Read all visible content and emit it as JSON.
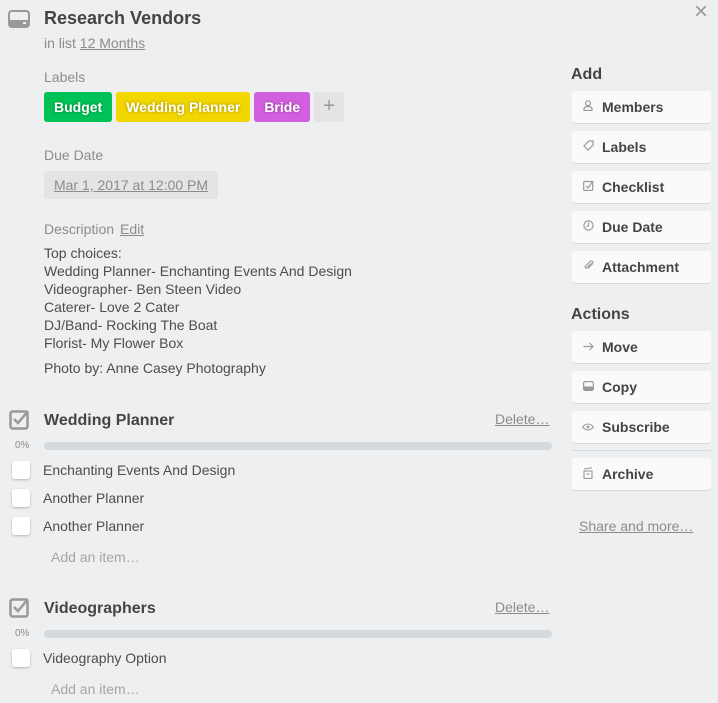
{
  "card": {
    "title": "Research Vendors",
    "in_list_prefix": "in list",
    "list_name": "12 Months"
  },
  "labels_section": {
    "heading": "Labels",
    "labels": [
      {
        "name": "Budget",
        "color": "#00c256"
      },
      {
        "name": "Wedding Planner",
        "color": "#f2d600"
      },
      {
        "name": "Bride",
        "color": "#d25fdf"
      }
    ],
    "add_symbol": "+"
  },
  "due_date": {
    "heading": "Due Date",
    "value": "Mar 1, 2017 at 12:00 PM"
  },
  "description": {
    "heading": "Description",
    "edit_label": "Edit",
    "lines": [
      "Top choices:",
      "Wedding Planner- Enchanting Events And Design",
      "Videographer- Ben Steen Video",
      "Caterer- Love 2 Cater",
      "DJ/Band- Rocking The Boat",
      "Florist- My Flower Box"
    ],
    "credit": "Photo by: Anne Casey Photography"
  },
  "checklists": [
    {
      "title": "Wedding Planner",
      "delete_label": "Delete…",
      "progress_percent": 0,
      "progress_text": "0%",
      "items": [
        "Enchanting Events And Design",
        "Another Planner",
        "Another Planner"
      ],
      "add_item_label": "Add an item…"
    },
    {
      "title": "Videographers",
      "delete_label": "Delete…",
      "progress_percent": 0,
      "progress_text": "0%",
      "items": [
        "Videography Option"
      ],
      "add_item_label": "Add an item…"
    }
  ],
  "sidebar": {
    "add_heading": "Add",
    "add_buttons": [
      {
        "label": "Members",
        "icon": "person-icon"
      },
      {
        "label": "Labels",
        "icon": "tag-icon"
      },
      {
        "label": "Checklist",
        "icon": "checkbox-icon"
      },
      {
        "label": "Due Date",
        "icon": "clock-icon"
      },
      {
        "label": "Attachment",
        "icon": "paperclip-icon"
      }
    ],
    "actions_heading": "Actions",
    "action_buttons": [
      {
        "label": "Move",
        "icon": "arrow-right-icon"
      },
      {
        "label": "Copy",
        "icon": "card-icon"
      },
      {
        "label": "Subscribe",
        "icon": "eye-icon"
      },
      {
        "label": "Archive",
        "icon": "archive-icon"
      }
    ],
    "share_label": "Share and more…"
  },
  "close_symbol": "×"
}
